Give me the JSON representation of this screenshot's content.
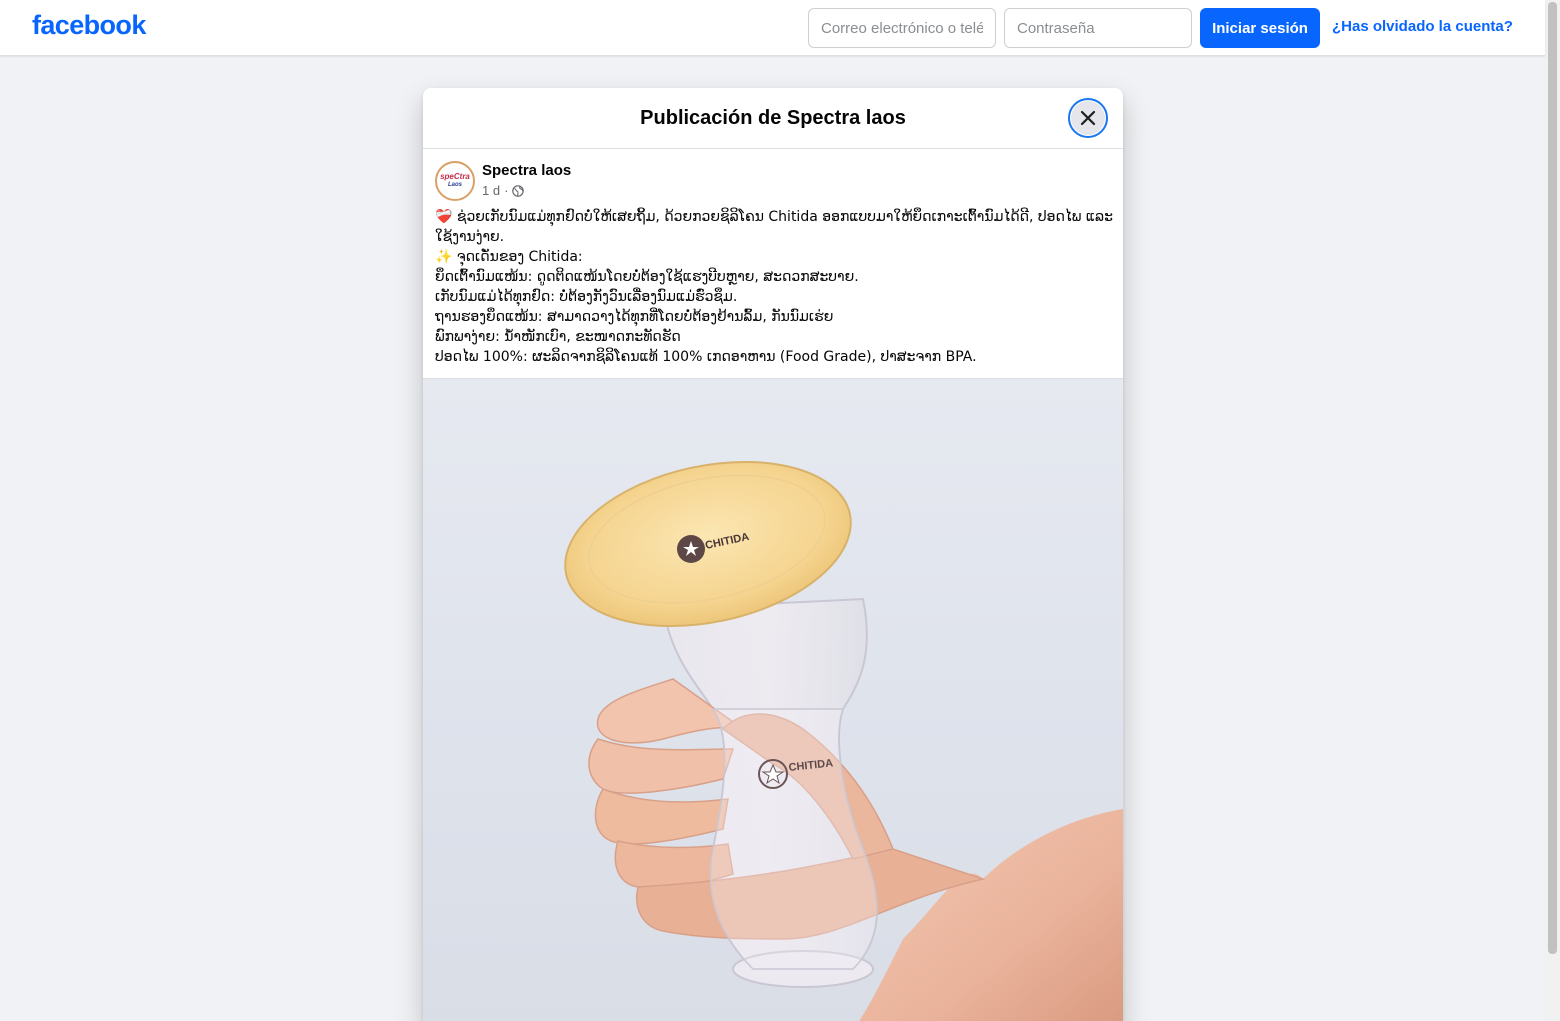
{
  "header": {
    "logo": "facebook",
    "email_placeholder": "Correo electrónico o teléfono",
    "password_placeholder": "Contraseña",
    "login_label": "Iniciar sesión",
    "forgot_label": "¿Has olvidado la cuenta?"
  },
  "modal": {
    "title": "Publicación de Spectra laos",
    "close_icon": "close-icon"
  },
  "post": {
    "author": "Spectra laos",
    "avatar_text_top": "speCtra",
    "avatar_text_bottom": "Laos",
    "time": "1 d",
    "separator": "·",
    "audience_icon": "globe-icon",
    "lines": [
      "❤️‍🩹 ຊ່ວຍເກັບນົມແມ່ທຸກຢົດບໍ່ໃຫ້ເສຍຖິ້ມ, ດ້ວຍກວຍຊິລິໂຄນ Chitida ອອກແບບມາໃຫ້ຍຶດເກາະເຕົ້ານົມໄດ້ດີ, ປອດໄພ ແລະ ໃຊ້ງານງ່າຍ.",
      "✨ ຈຸດເດັ່ນຂອງ Chitida:",
      "ຍຶດເຕົ້ານົມແໜ້ນ: ດູດຕິດແໜ້ນໂດຍບໍ່ຕ້ອງໃຊ້ແຮງບີບຫຼາຍ, ສະດວກສະບາຍ.",
      "ເກັບນົມແມ່ໄດ້ທຸກຢົດ: ບໍ່ຕ້ອງກັງວົນເລື່ອງນົມແມ່ຮົ່ວຊຶມ.",
      "ຖານຮອງຍຶດແໜ້ນ: ສາມາດວາງໄດ້ທຸກທີ່ໂດຍບໍ່ຕ້ອງຢ້ານລົ້ມ, ກັນນົມເຮ່ຍ",
      "ພົກພາງ່າຍ: ນ້ຳໜັກເບົາ, ຂະໜາດກະທັດຮັດ",
      "ປອດໄພ 100%: ຜະລິດຈາກຊິລິໂຄນແທ້ 100% ເກດອາຫານ (Food Grade), ປາສະຈາກ BPA."
    ],
    "image": {
      "lid_brand": "CHITIDA",
      "body_brand": "CHITIDA"
    }
  },
  "colors": {
    "brand_blue": "#0866ff",
    "page_bg": "#f0f2f5",
    "lid_yellow": "#f7dca0"
  }
}
